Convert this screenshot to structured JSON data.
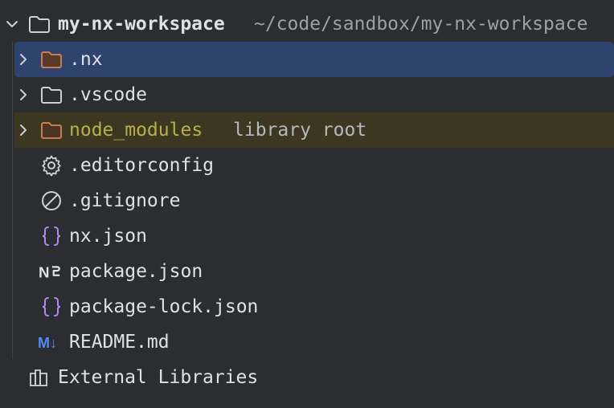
{
  "project": {
    "name": "my-nx-workspace",
    "path": "~/code/sandbox/my-nx-workspace"
  },
  "items": [
    {
      "name": ".nx",
      "type": "folder",
      "icon": "folder-icon-orange",
      "expandable": true,
      "selected": true
    },
    {
      "name": ".vscode",
      "type": "folder",
      "icon": "folder-icon",
      "expandable": true
    },
    {
      "name": "node_modules",
      "hint": "library root",
      "type": "folder",
      "icon": "folder-icon-orange",
      "expandable": true,
      "excluded": true
    },
    {
      "name": ".editorconfig",
      "type": "file",
      "icon": "gear-icon"
    },
    {
      "name": ".gitignore",
      "type": "file",
      "icon": "ignore-icon"
    },
    {
      "name": "nx.json",
      "type": "file",
      "icon": "json-icon"
    },
    {
      "name": "package.json",
      "type": "file",
      "icon": "npm-icon"
    },
    {
      "name": "package-lock.json",
      "type": "file",
      "icon": "json-icon"
    },
    {
      "name": "README.md",
      "type": "file",
      "icon": "markdown-icon"
    }
  ],
  "external": {
    "name": "External Libraries",
    "icon": "library-icon"
  },
  "icon_labels": {
    "npm": "N",
    "markdown": "M↓"
  },
  "colors": {
    "background": "#2b2d30",
    "selection": "#2e436e",
    "excluded_row": "#3d3722",
    "folder_orange": "#c97c4d",
    "json_purple": "#b189f5",
    "markdown_blue": "#548af7",
    "node_modules_text": "#b5b04a"
  }
}
